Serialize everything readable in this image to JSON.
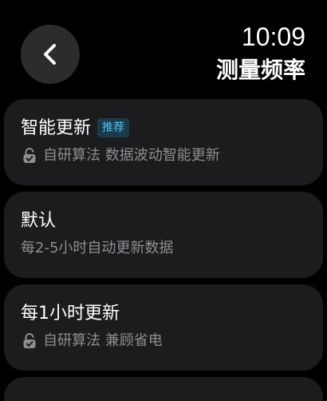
{
  "header": {
    "time": "10:09",
    "title": "测量频率"
  },
  "options": [
    {
      "title": "智能更新",
      "badge": "推荐",
      "subtitle": "自研算法 数据波动智能更新",
      "icon": "lock-check-icon"
    },
    {
      "title": "默认",
      "subtitle": "每2-5小时自动更新数据"
    },
    {
      "title": "每1小时更新",
      "subtitle": "自研算法 兼顾省电",
      "icon": "lock-check-icon"
    }
  ],
  "colors": {
    "background": "#000000",
    "card": "#1c1c1e",
    "badge_text": "#4fc3f7",
    "secondary_text": "#8e8e93"
  }
}
